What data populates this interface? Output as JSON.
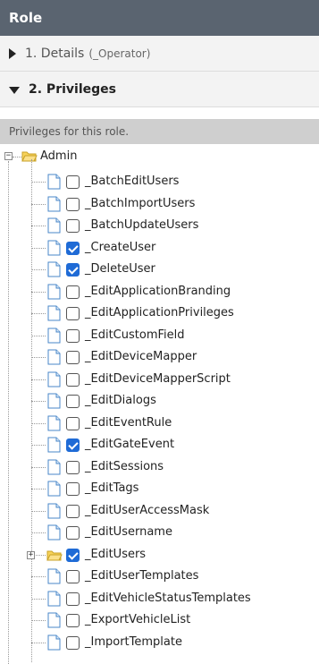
{
  "header": {
    "title": "Role"
  },
  "sections": [
    {
      "label": "1. Details",
      "sub": "(_Operator)",
      "expanded": false
    },
    {
      "label": "2. Privileges",
      "expanded": true
    }
  ],
  "description": "Privileges for this role.",
  "tree": {
    "root_label": "Admin",
    "items": [
      {
        "label": "_BatchEditUsers",
        "checked": false
      },
      {
        "label": "_BatchImportUsers",
        "checked": false
      },
      {
        "label": "_BatchUpdateUsers",
        "checked": false
      },
      {
        "label": "_CreateUser",
        "checked": true
      },
      {
        "label": "_DeleteUser",
        "checked": true
      },
      {
        "label": "_EditApplicationBranding",
        "checked": false
      },
      {
        "label": "_EditApplicationPrivileges",
        "checked": false
      },
      {
        "label": "_EditCustomField",
        "checked": false
      },
      {
        "label": "_EditDeviceMapper",
        "checked": false
      },
      {
        "label": "_EditDeviceMapperScript",
        "checked": false
      },
      {
        "label": "_EditDialogs",
        "checked": false
      },
      {
        "label": "_EditEventRule",
        "checked": false
      },
      {
        "label": "_EditGateEvent",
        "checked": true
      },
      {
        "label": "_EditSessions",
        "checked": false
      },
      {
        "label": "_EditTags",
        "checked": false
      },
      {
        "label": "_EditUserAccessMask",
        "checked": false
      },
      {
        "label": "_EditUsername",
        "checked": false
      },
      {
        "label": "_EditUsers",
        "checked": true,
        "folder": true
      },
      {
        "label": "_EditUserTemplates",
        "checked": false
      },
      {
        "label": "_EditVehicleStatusTemplates",
        "checked": false
      },
      {
        "label": "_ExportVehicleList",
        "checked": false
      },
      {
        "label": "_ImportTemplate",
        "checked": false
      }
    ]
  },
  "colors": {
    "header_bg": "#5a6470",
    "check_accent": "#1f6bd6",
    "folder_fill": "#f7d25a"
  }
}
